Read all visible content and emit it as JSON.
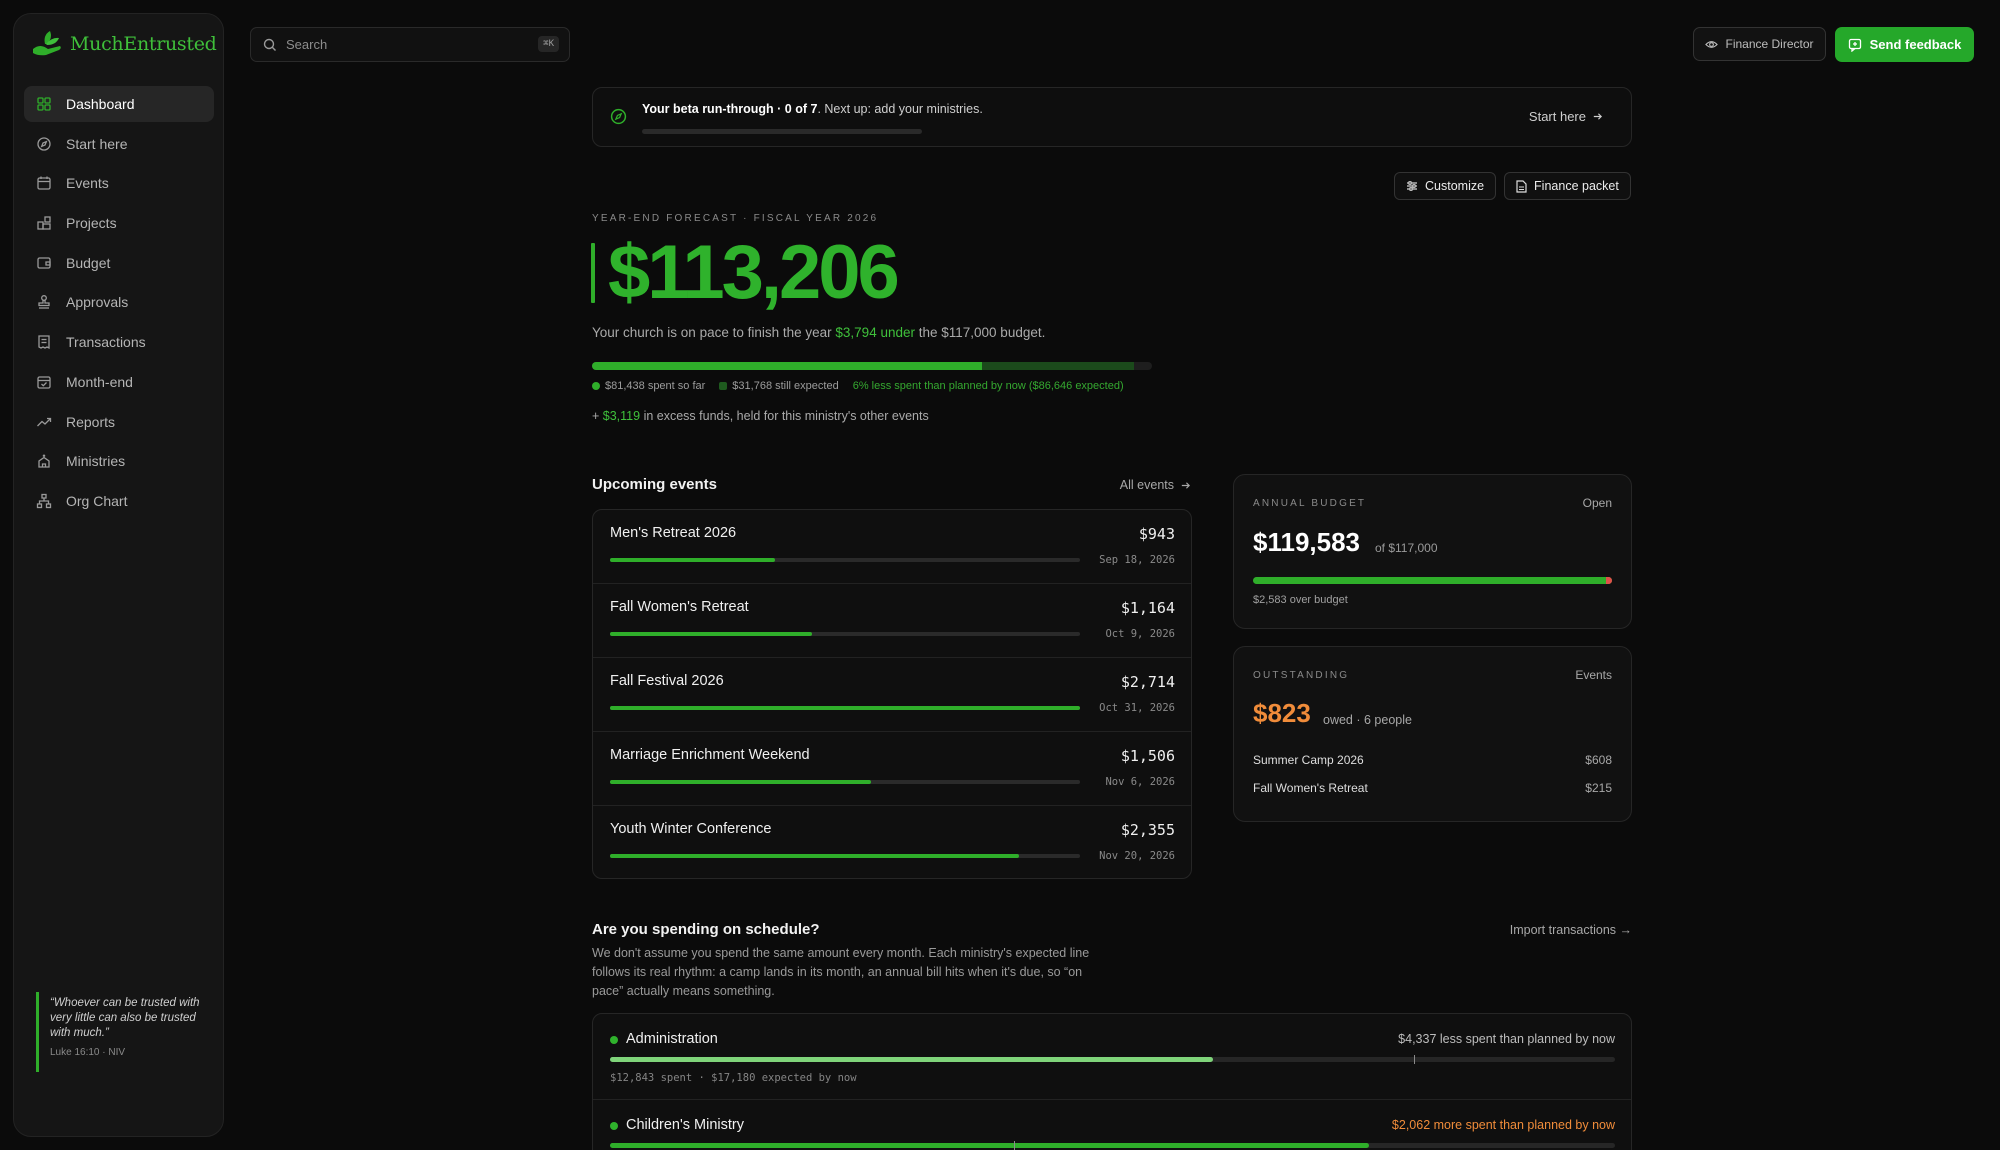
{
  "app": {
    "name": "MuchEntrusted"
  },
  "sidebar": {
    "items": [
      {
        "label": "Dashboard",
        "icon": "dashboard-icon",
        "active": true
      },
      {
        "label": "Start here",
        "icon": "compass-icon"
      },
      {
        "label": "Events",
        "icon": "calendar-icon"
      },
      {
        "label": "Projects",
        "icon": "projects-icon"
      },
      {
        "label": "Budget",
        "icon": "wallet-icon"
      },
      {
        "label": "Approvals",
        "icon": "stamp-icon"
      },
      {
        "label": "Transactions",
        "icon": "receipt-icon"
      },
      {
        "label": "Month-end",
        "icon": "calendar-check-icon"
      },
      {
        "label": "Reports",
        "icon": "trend-icon"
      },
      {
        "label": "Ministries",
        "icon": "church-icon"
      },
      {
        "label": "Org Chart",
        "icon": "org-chart-icon"
      }
    ],
    "quote": {
      "text": "“Whoever can be trusted with very little can also be trusted with much.”",
      "ref": "Luke 16:10 · NIV"
    }
  },
  "topbar": {
    "search_placeholder": "Search",
    "search_shortcut": "⌘K",
    "role_label": "Finance Director",
    "feedback_label": "Send feedback"
  },
  "beta": {
    "bold": "Your beta run-through · 0 of 7",
    "rest": ". Next up: add your ministries.",
    "progress": 0,
    "cta": "Start here"
  },
  "actions": {
    "customize": "Customize",
    "finance_packet": "Finance packet"
  },
  "forecast": {
    "kicker": "Year-end forecast · Fiscal year 2026",
    "amount": "$113,206",
    "pace_prefix": "Your church is on pace to finish the year ",
    "pace_highlight": "$3,794 under",
    "pace_suffix": " the $117,000 budget.",
    "spent_fraction": 0.696,
    "expected_fraction": 0.272,
    "legend_spent": "$81,438 spent so far",
    "legend_expected": "$31,768 still expected",
    "legend_note": "6% less spent than planned by now ($86,646 expected)",
    "excess_prefix": "+ ",
    "excess_amount": "$3,119",
    "excess_suffix": " in excess funds, held for this ministry's other events"
  },
  "events": {
    "title": "Upcoming events",
    "all_link": "All events",
    "rows": [
      {
        "name": "Men's Retreat 2026",
        "amount": "$943",
        "date": "Sep 18, 2026",
        "progress": 0.35
      },
      {
        "name": "Fall Women's Retreat",
        "amount": "$1,164",
        "date": "Oct 9, 2026",
        "progress": 0.43
      },
      {
        "name": "Fall Festival 2026",
        "amount": "$2,714",
        "date": "Oct 31, 2026",
        "progress": 1.0
      },
      {
        "name": "Marriage Enrichment Weekend",
        "amount": "$1,506",
        "date": "Nov 6, 2026",
        "progress": 0.555
      },
      {
        "name": "Youth Winter Conference",
        "amount": "$2,355",
        "date": "Nov 20, 2026",
        "progress": 0.87
      }
    ]
  },
  "annual_budget": {
    "kicker": "Annual budget",
    "link": "Open",
    "amount": "$119,583",
    "of": "of $117,000",
    "progress": 1.0,
    "note": "$2,583 over budget",
    "colors": {
      "fill": "#2fae2a",
      "over": "#e0504a"
    }
  },
  "outstanding": {
    "kicker": "Outstanding",
    "link": "Events",
    "amount": "$823",
    "sub": "owed · 6 people",
    "rows": [
      {
        "name": "Summer Camp 2026",
        "amount": "$608"
      },
      {
        "name": "Fall Women's Retreat",
        "amount": "$215"
      }
    ]
  },
  "schedule": {
    "title": "Are you spending on schedule?",
    "import_link": "Import transactions →",
    "description": "We don't assume you spend the same amount every month. Each ministry's expected line follows its real rhythm: a camp lands in its month, an annual bill hits when it's due, so “on pace” actually means something.",
    "ministries": [
      {
        "name": "Administration",
        "status": "$4,337 less spent than planned by now",
        "status_kind": "under",
        "spent_fraction": 0.6,
        "expected_fraction": 0.8,
        "detail": "$12,843 spent · $17,180 expected by now"
      },
      {
        "name": "Children's Ministry",
        "status": "$2,062 more spent than planned by now",
        "status_kind": "over",
        "spent_fraction": 0.755,
        "expected_fraction": 0.402,
        "detail": ""
      }
    ],
    "colors": {
      "under": "#bdbdbd",
      "over": "#f08c3a",
      "fill_under": "#7fd47a",
      "fill_over": "#2fae2a"
    }
  }
}
